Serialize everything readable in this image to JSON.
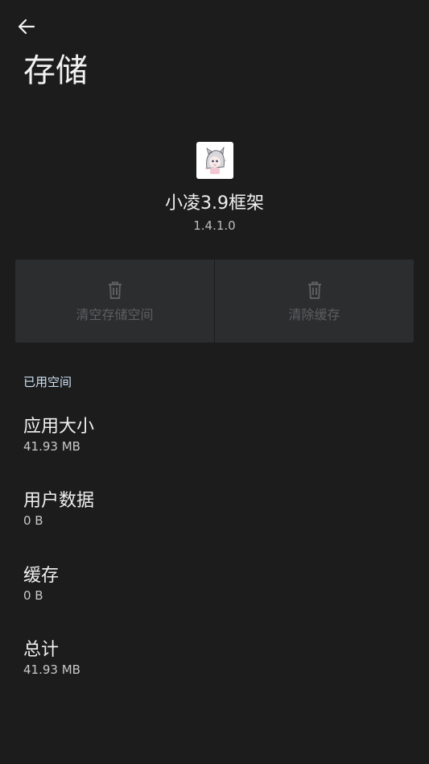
{
  "header": {
    "title": "存储"
  },
  "app": {
    "name": "小凌3.9框架",
    "version": "1.4.1.0"
  },
  "actions": [
    {
      "label": "清空存储空间",
      "icon": "trash-icon",
      "enabled": false
    },
    {
      "label": "清除缓存",
      "icon": "trash-icon",
      "enabled": false
    }
  ],
  "section": {
    "title": "已用空间"
  },
  "stats": [
    {
      "title": "应用大小",
      "value": "41.93 MB"
    },
    {
      "title": "用户数据",
      "value": "0 B"
    },
    {
      "title": "缓存",
      "value": "0 B"
    },
    {
      "title": "总计",
      "value": "41.93 MB"
    }
  ],
  "colors": {
    "background": "#1c1c1c",
    "card": "#2c2d2f",
    "disabled_text": "#5d5e60",
    "accent_header": "#cfe3f7"
  }
}
